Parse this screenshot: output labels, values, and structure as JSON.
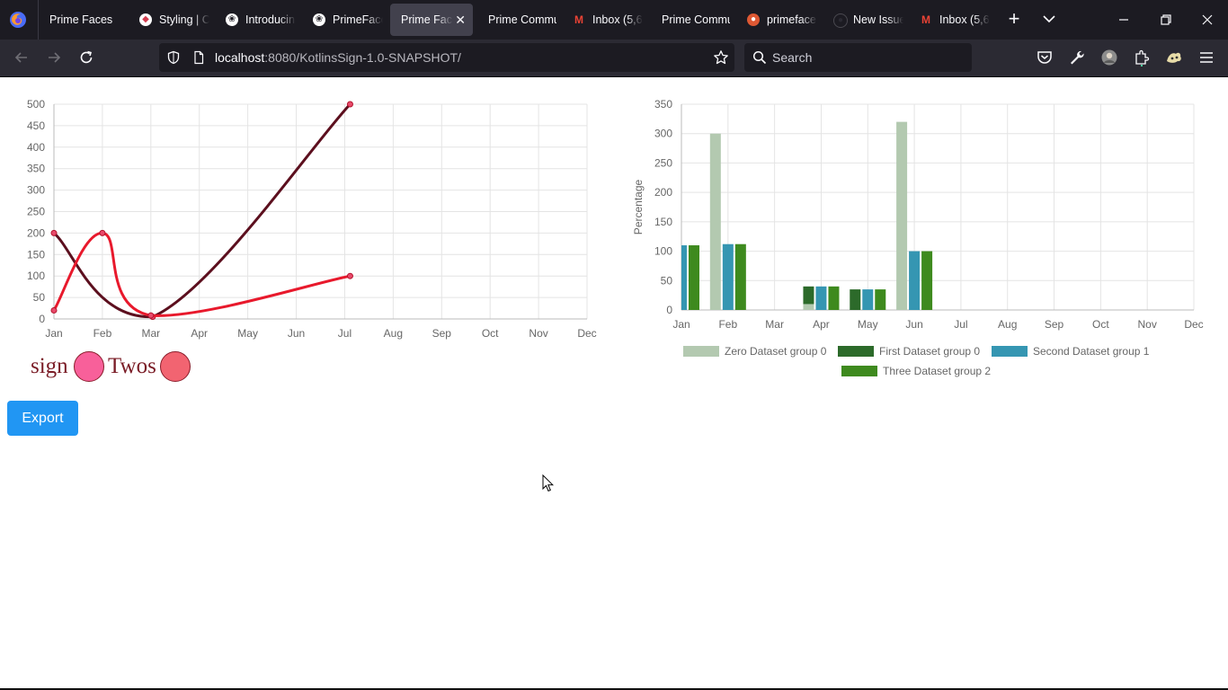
{
  "browser": {
    "tabs": [
      {
        "title": "Prime Faces",
        "favicon": "none",
        "active": false,
        "x": 0,
        "w": 88
      },
      {
        "title": "Styling | C",
        "favicon": "cube-icon",
        "active": false,
        "x": 102,
        "w": 88
      },
      {
        "title": "Introducin",
        "favicon": "openai-icon",
        "active": false,
        "x": 198,
        "w": 88
      },
      {
        "title": "PrimeFace",
        "favicon": "openai-icon",
        "active": false,
        "x": 295,
        "w": 88
      },
      {
        "title": "Prime Faces",
        "favicon": "none",
        "active": true,
        "x": 391,
        "w": 92
      },
      {
        "title": "Prime Commu",
        "favicon": "none",
        "active": false,
        "x": 488,
        "w": 88
      },
      {
        "title": "Inbox (5,6",
        "favicon": "gmail-icon",
        "active": false,
        "x": 584,
        "w": 88
      },
      {
        "title": "Prime Commu",
        "favicon": "none",
        "active": false,
        "x": 681,
        "w": 88
      },
      {
        "title": "primeface",
        "favicon": "duckduckgo-icon",
        "active": false,
        "x": 778,
        "w": 88
      },
      {
        "title": "New Issue",
        "favicon": "github-icon",
        "active": false,
        "x": 874,
        "w": 88
      },
      {
        "title": "Inbox (5,6",
        "favicon": "gmail-icon",
        "active": false,
        "x": 970,
        "w": 88
      }
    ],
    "url_host": "localhost",
    "url_rest": ":8080/KotlinsSign-1.0-SNAPSHOT/",
    "search_placeholder": "Search",
    "colors": {
      "tabbar": "#1c1b22",
      "toolbar": "#2b2a33",
      "active_tab": "#42414d"
    }
  },
  "page": {
    "signature": {
      "word1": "sign",
      "word2": "Twos",
      "dot1_color": "#f8609a",
      "dot2_color": "#f26471"
    },
    "export_label": "Export"
  },
  "chart_data": [
    {
      "type": "line",
      "categories": [
        "Jan",
        "Feb",
        "Mar",
        "Apr",
        "May",
        "Jun",
        "Jul",
        "Aug",
        "Sep",
        "Oct",
        "Nov",
        "Dec"
      ],
      "ylim": [
        0,
        500
      ],
      "yticks": [
        0,
        50,
        100,
        150,
        200,
        250,
        300,
        350,
        400,
        450,
        500
      ],
      "grid": true,
      "series": [
        {
          "values": [
            200,
            null,
            5,
            null,
            null,
            null,
            500
          ],
          "color": "#5c0f1e",
          "dx": [
            0,
            0,
            2.0,
            0,
            0,
            0,
            6.0
          ],
          "point_color": "#e84a6b"
        },
        {
          "values": [
            20,
            200,
            8,
            null,
            null,
            null,
            100
          ],
          "color": "#e8192c",
          "dx": [
            0,
            0,
            0,
            0,
            0,
            0,
            6.0
          ],
          "point_color": "#e84a6b"
        }
      ]
    },
    {
      "type": "bar",
      "categories": [
        "Jan",
        "Feb",
        "Mar",
        "Apr",
        "May",
        "Jun",
        "Jul",
        "Aug",
        "Sep",
        "Oct",
        "Nov",
        "Dec"
      ],
      "ylabel": "Percentage",
      "ylim": [
        0,
        350
      ],
      "yticks": [
        0,
        50,
        100,
        150,
        200,
        250,
        300,
        350
      ],
      "grid": true,
      "legend_position": "bottom",
      "series": [
        {
          "name": "Zero Dataset group 0",
          "stack": 0,
          "color": "#b3c9b0",
          "values": [
            0,
            300,
            0,
            10,
            0,
            320,
            0,
            0,
            0,
            0,
            0,
            0
          ]
        },
        {
          "name": "First Dataset group 0",
          "stack": 0,
          "color": "#2c6a2a",
          "values": [
            0,
            0,
            0,
            30,
            35,
            0,
            0,
            0,
            0,
            0,
            0,
            0
          ]
        },
        {
          "name": "Second Dataset group 1",
          "stack": 1,
          "color": "#3596b2",
          "values": [
            110,
            112,
            0,
            40,
            35,
            100,
            0,
            0,
            0,
            0,
            0,
            0
          ]
        },
        {
          "name": "Three Dataset group 2",
          "stack": 2,
          "color": "#3e8a1e",
          "values": [
            110,
            112,
            0,
            40,
            35,
            100,
            0,
            0,
            0,
            0,
            0,
            0
          ]
        }
      ]
    }
  ]
}
